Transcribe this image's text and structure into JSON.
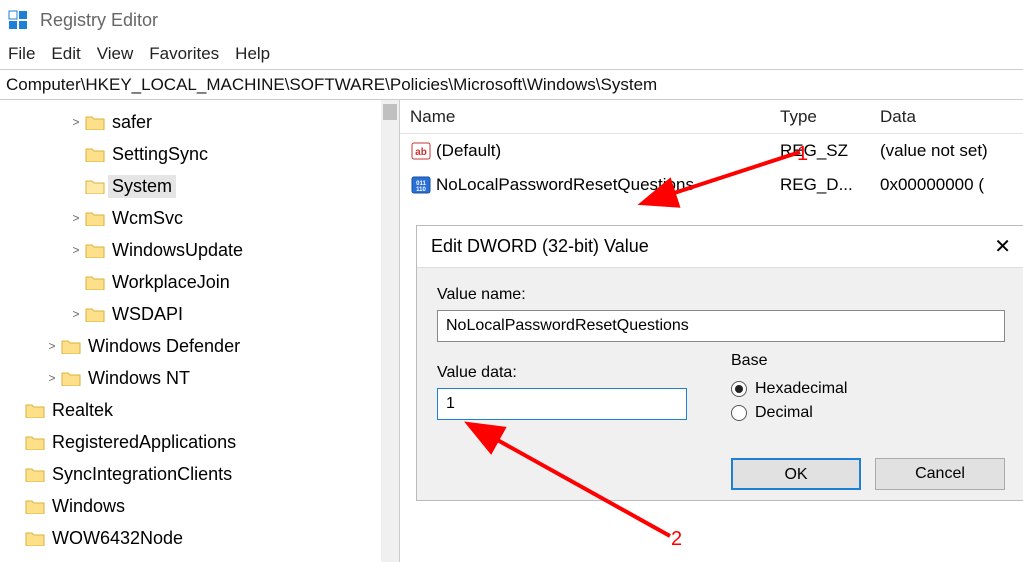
{
  "app": {
    "title": "Registry Editor"
  },
  "menu": {
    "file": "File",
    "edit": "Edit",
    "view": "View",
    "favorites": "Favorites",
    "help": "Help"
  },
  "address": "Computer\\HKEY_LOCAL_MACHINE\\SOFTWARE\\Policies\\Microsoft\\Windows\\System",
  "tree": [
    {
      "indent": 60,
      "caret": ">",
      "label": "safer"
    },
    {
      "indent": 60,
      "caret": "",
      "label": "SettingSync"
    },
    {
      "indent": 60,
      "caret": "",
      "label": "System",
      "selected": true
    },
    {
      "indent": 60,
      "caret": ">",
      "label": "WcmSvc"
    },
    {
      "indent": 60,
      "caret": ">",
      "label": "WindowsUpdate"
    },
    {
      "indent": 60,
      "caret": "",
      "label": "WorkplaceJoin"
    },
    {
      "indent": 60,
      "caret": ">",
      "label": "WSDAPI"
    },
    {
      "indent": 36,
      "caret": ">",
      "label": "Windows Defender"
    },
    {
      "indent": 36,
      "caret": ">",
      "label": "Windows NT"
    },
    {
      "indent": 0,
      "caret": "",
      "label": "Realtek"
    },
    {
      "indent": 0,
      "caret": "",
      "label": "RegisteredApplications"
    },
    {
      "indent": 0,
      "caret": "",
      "label": "SyncIntegrationClients"
    },
    {
      "indent": 0,
      "caret": "",
      "label": "Windows"
    },
    {
      "indent": 0,
      "caret": "",
      "label": "WOW6432Node"
    }
  ],
  "list": {
    "headers": {
      "name": "Name",
      "type": "Type",
      "data": "Data"
    },
    "rows": [
      {
        "icon": "string",
        "name": "(Default)",
        "type": "REG_SZ",
        "data": "(value not set)"
      },
      {
        "icon": "binary",
        "name": "NoLocalPasswordResetQuestions",
        "type": "REG_D...",
        "data": "0x00000000 ("
      }
    ]
  },
  "dialog": {
    "title": "Edit DWORD (32-bit) Value",
    "valueNameLabel": "Value name:",
    "valueName": "NoLocalPasswordResetQuestions",
    "valueDataLabel": "Value data:",
    "valueData": "1",
    "baseLabel": "Base",
    "hex": "Hexadecimal",
    "dec": "Decimal",
    "ok": "OK",
    "cancel": "Cancel"
  },
  "annotations": {
    "one": "1",
    "two": "2"
  }
}
